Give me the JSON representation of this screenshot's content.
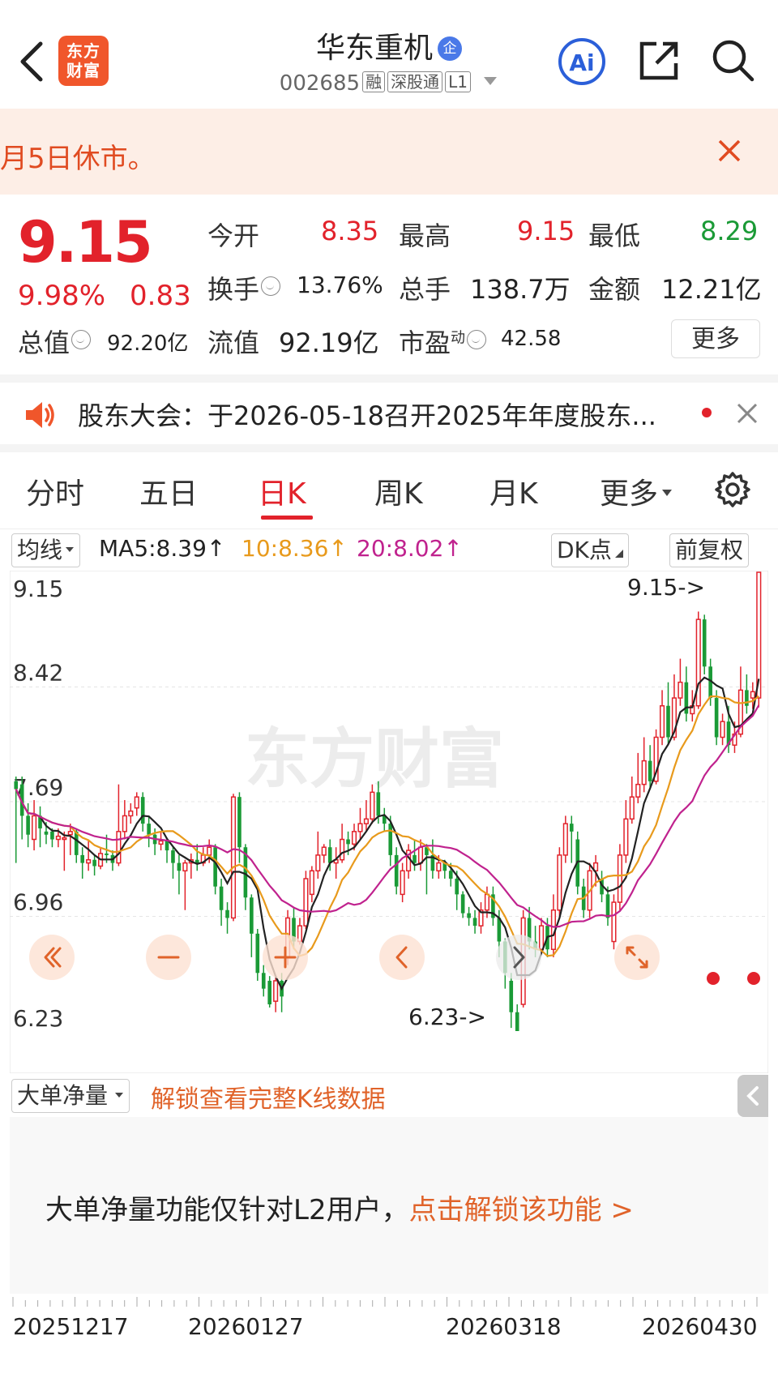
{
  "header": {
    "logo_line1": "东方",
    "logo_line2": "财富",
    "stock_name": "华东重机",
    "badge": "企",
    "code": "002685",
    "tags": [
      "融",
      "深股通",
      "L1"
    ]
  },
  "notice": {
    "text": "月5日休市。"
  },
  "quote": {
    "price": "9.15",
    "change_pct": "9.98%",
    "change": "0.83",
    "fields": {
      "open_label": "今开",
      "open": "8.35",
      "high_label": "最高",
      "high": "9.15",
      "low_label": "最低",
      "low": "8.29",
      "turnover_label": "换手",
      "turnover": "13.76%",
      "volume_label": "总手",
      "volume": "138.7万",
      "amount_label": "金额",
      "amount": "12.21亿",
      "mktcap_label": "总值",
      "mktcap": "92.20亿",
      "float_label": "流值",
      "float_cap": "92.19亿",
      "pe_label": "市盈",
      "pe_sup": "动",
      "pe": "42.58"
    },
    "more_label": "更多"
  },
  "announcement": {
    "text": "股东大会：于2026-05-18召开2025年年度股东..."
  },
  "tabs": [
    "分时",
    "五日",
    "日K",
    "周K",
    "月K",
    "更多"
  ],
  "active_tab": "日K",
  "ma_bar": {
    "selector": "均线",
    "ma5": "MA5:8.39",
    "ma10": "10:8.36",
    "ma20": "20:8.02",
    "arrow": "↑",
    "dk_label": "DK点",
    "fq_label": "前复权"
  },
  "colors": {
    "up": "#e2222b",
    "down": "#1a9a36",
    "ma5": "#222222",
    "ma10": "#e89a1c",
    "ma20": "#c0228e",
    "accent": "#e0632a"
  },
  "chart_data": {
    "type": "candlestick",
    "y_ticks": [
      "9.15",
      "8.42",
      "7.69",
      "6.96",
      "6.23"
    ],
    "ylim": [
      6.23,
      9.15
    ],
    "max_marker": "9.15->",
    "min_marker": "6.23->",
    "watermark": "东方财富",
    "x_labels": [
      "20251217",
      "20260127",
      "20260318",
      "20260430"
    ],
    "candles": [
      [
        7.82,
        7.77,
        7.85,
        7.3
      ],
      [
        7.8,
        7.6,
        7.85,
        7.45
      ],
      [
        7.6,
        7.48,
        7.68,
        7.4
      ],
      [
        7.45,
        7.6,
        7.7,
        7.38
      ],
      [
        7.6,
        7.52,
        7.66,
        7.4
      ],
      [
        7.5,
        7.48,
        7.56,
        7.42
      ],
      [
        7.5,
        7.45,
        7.52,
        7.4
      ],
      [
        7.45,
        7.47,
        7.52,
        7.4
      ],
      [
        7.45,
        7.46,
        7.5,
        7.25
      ],
      [
        7.48,
        7.5,
        7.55,
        7.35
      ],
      [
        7.5,
        7.35,
        7.52,
        7.3
      ],
      [
        7.35,
        7.3,
        7.4,
        7.2
      ],
      [
        7.3,
        7.32,
        7.45,
        7.25
      ],
      [
        7.32,
        7.28,
        7.35,
        7.22
      ],
      [
        7.28,
        7.36,
        7.4,
        7.26
      ],
      [
        7.36,
        7.35,
        7.48,
        7.3
      ],
      [
        7.35,
        7.3,
        7.38,
        7.25
      ],
      [
        7.3,
        7.5,
        7.8,
        7.28
      ],
      [
        7.5,
        7.6,
        7.7,
        7.45
      ],
      [
        7.6,
        7.63,
        7.68,
        7.55
      ],
      [
        7.65,
        7.72,
        7.75,
        7.6
      ],
      [
        7.72,
        7.55,
        7.75,
        7.5
      ],
      [
        7.55,
        7.48,
        7.6,
        7.4
      ],
      [
        7.48,
        7.42,
        7.52,
        7.35
      ],
      [
        7.42,
        7.44,
        7.5,
        7.38
      ],
      [
        7.44,
        7.38,
        7.46,
        7.3
      ],
      [
        7.38,
        7.3,
        7.4,
        7.2
      ],
      [
        7.3,
        7.25,
        7.35,
        7.1
      ],
      [
        7.25,
        7.3,
        7.32,
        7.0
      ],
      [
        7.3,
        7.32,
        7.36,
        7.2
      ],
      [
        7.32,
        7.3,
        7.42,
        7.25
      ],
      [
        7.3,
        7.35,
        7.4,
        7.28
      ],
      [
        7.35,
        7.4,
        7.45,
        7.3
      ],
      [
        7.4,
        7.15,
        7.42,
        7.1
      ],
      [
        7.15,
        7.0,
        7.2,
        6.9
      ],
      [
        7.0,
        6.95,
        7.05,
        6.85
      ],
      [
        6.95,
        7.72,
        7.74,
        6.93
      ],
      [
        7.72,
        7.4,
        7.75,
        7.3
      ],
      [
        7.4,
        7.08,
        7.42,
        7.0
      ],
      [
        7.08,
        6.85,
        7.1,
        6.7
      ],
      [
        6.85,
        6.6,
        6.88,
        6.55
      ],
      [
        6.6,
        6.5,
        6.65,
        6.45
      ],
      [
        6.55,
        6.4,
        6.58,
        6.38
      ],
      [
        6.42,
        6.55,
        6.58,
        6.35
      ],
      [
        6.55,
        6.45,
        6.6,
        6.35
      ],
      [
        6.7,
        6.95,
        7.0,
        6.65
      ],
      [
        6.95,
        6.8,
        7.02,
        6.75
      ],
      [
        6.8,
        6.9,
        6.95,
        6.78
      ],
      [
        6.9,
        7.2,
        7.25,
        6.88
      ],
      [
        7.1,
        7.25,
        7.28,
        7.05
      ],
      [
        7.25,
        7.35,
        7.5,
        7.2
      ],
      [
        7.35,
        7.4,
        7.42,
        7.3
      ],
      [
        7.4,
        7.3,
        7.45,
        7.25
      ],
      [
        7.3,
        7.32,
        7.4,
        7.2
      ],
      [
        7.32,
        7.45,
        7.55,
        7.3
      ],
      [
        7.45,
        7.42,
        7.5,
        7.35
      ],
      [
        7.42,
        7.5,
        7.55,
        7.38
      ],
      [
        7.5,
        7.55,
        7.65,
        7.45
      ],
      [
        7.55,
        7.58,
        7.7,
        7.5
      ],
      [
        7.58,
        7.75,
        7.8,
        7.55
      ],
      [
        7.75,
        7.6,
        7.82,
        7.55
      ],
      [
        7.6,
        7.55,
        7.65,
        7.5
      ],
      [
        7.55,
        7.35,
        7.6,
        7.28
      ],
      [
        7.35,
        7.15,
        7.4,
        7.1
      ],
      [
        7.1,
        7.25,
        7.3,
        7.05
      ],
      [
        7.25,
        7.38,
        7.42,
        7.2
      ],
      [
        7.35,
        7.3,
        7.45,
        7.25
      ],
      [
        7.3,
        7.4,
        7.45,
        7.25
      ],
      [
        7.4,
        7.35,
        7.42,
        7.1
      ],
      [
        7.35,
        7.25,
        7.45,
        7.2
      ],
      [
        7.25,
        7.3,
        7.35,
        7.2
      ],
      [
        7.3,
        7.25,
        7.32,
        7.2
      ],
      [
        7.25,
        7.2,
        7.3,
        7.15
      ],
      [
        7.2,
        7.1,
        7.25,
        7.0
      ],
      [
        7.1,
        6.98,
        7.12,
        6.95
      ],
      [
        6.98,
        6.95,
        7.02,
        6.9
      ],
      [
        6.95,
        6.9,
        7.0,
        6.85
      ],
      [
        6.9,
        7.0,
        7.05,
        6.85
      ],
      [
        7.0,
        7.1,
        7.15,
        6.95
      ],
      [
        7.1,
        6.95,
        7.15,
        6.9
      ],
      [
        6.95,
        6.8,
        7.0,
        6.7
      ],
      [
        6.8,
        6.6,
        6.82,
        6.5
      ],
      [
        6.55,
        6.35,
        6.6,
        6.25
      ],
      [
        6.35,
        6.23,
        6.4,
        6.23
      ],
      [
        6.4,
        6.95,
        7.0,
        6.38
      ],
      [
        6.95,
        6.8,
        7.02,
        6.75
      ],
      [
        6.8,
        6.75,
        6.9,
        6.7
      ],
      [
        6.75,
        6.9,
        6.95,
        6.72
      ],
      [
        6.9,
        6.75,
        6.95,
        6.7
      ],
      [
        6.75,
        7.0,
        7.1,
        6.7
      ],
      [
        7.0,
        7.35,
        7.4,
        6.95
      ],
      [
        7.35,
        7.55,
        7.6,
        7.3
      ],
      [
        7.55,
        7.5,
        7.6,
        7.3
      ],
      [
        7.45,
        7.15,
        7.5,
        7.1
      ],
      [
        7.15,
        7.0,
        7.2,
        6.95
      ],
      [
        7.0,
        7.25,
        7.3,
        6.95
      ],
      [
        7.25,
        7.3,
        7.35,
        7.15
      ],
      [
        7.2,
        7.1,
        7.25,
        7.05
      ],
      [
        7.1,
        6.95,
        7.15,
        6.9
      ],
      [
        6.8,
        7.05,
        7.1,
        6.75
      ],
      [
        7.05,
        7.35,
        7.42,
        7.0
      ],
      [
        7.35,
        7.58,
        7.7,
        7.3
      ],
      [
        7.58,
        7.72,
        7.85,
        7.55
      ],
      [
        7.72,
        7.8,
        8.0,
        7.68
      ],
      [
        7.8,
        7.95,
        8.1,
        7.75
      ],
      [
        7.95,
        7.82,
        8.05,
        7.78
      ],
      [
        7.82,
        8.1,
        8.15,
        7.8
      ],
      [
        8.1,
        8.3,
        8.4,
        8.05
      ],
      [
        8.3,
        8.1,
        8.45,
        8.05
      ],
      [
        8.1,
        8.35,
        8.5,
        8.08
      ],
      [
        8.35,
        8.45,
        8.6,
        8.3
      ],
      [
        8.45,
        8.25,
        8.55,
        8.2
      ],
      [
        8.25,
        8.3,
        8.4,
        8.2
      ],
      [
        8.3,
        8.85,
        8.9,
        8.28
      ],
      [
        8.85,
        8.55,
        8.88,
        8.5
      ],
      [
        8.55,
        8.35,
        8.6,
        8.3
      ],
      [
        8.35,
        8.1,
        8.4,
        8.05
      ],
      [
        8.1,
        8.2,
        8.25,
        8.05
      ],
      [
        8.2,
        8.05,
        8.3,
        8.0
      ],
      [
        8.05,
        8.12,
        8.2,
        8.0
      ],
      [
        8.12,
        8.4,
        8.55,
        8.1
      ],
      [
        8.4,
        8.3,
        8.5,
        8.25
      ],
      [
        8.35,
        8.39,
        8.45,
        8.28
      ],
      [
        8.35,
        9.15,
        9.15,
        8.29
      ]
    ]
  },
  "bottom": {
    "selector": "大单净量",
    "unlock_text": "解锁查看完整K线数据",
    "panel_text": "大单净量功能仅针对L2用户，",
    "panel_link": "点击解锁该功能 >"
  }
}
